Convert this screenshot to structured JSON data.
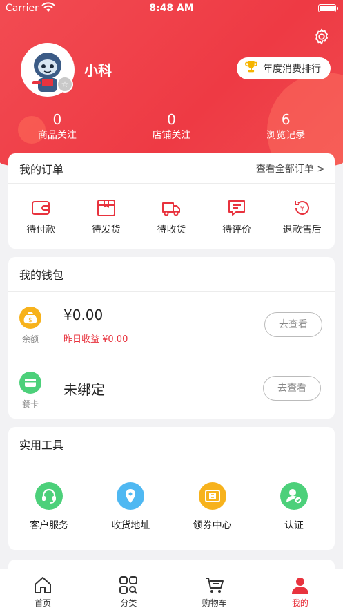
{
  "status_bar": {
    "carrier": "Carrier",
    "time": "8:48 AM"
  },
  "profile": {
    "username": "小科",
    "rank_button": "年度消费排行"
  },
  "stats": [
    {
      "value": "0",
      "label": "商品关注"
    },
    {
      "value": "0",
      "label": "店铺关注"
    },
    {
      "value": "6",
      "label": "浏览记录"
    }
  ],
  "orders": {
    "title": "我的订单",
    "view_all": "查看全部订单 >",
    "items": [
      {
        "label": "待付款",
        "icon": "wallet-icon"
      },
      {
        "label": "待发货",
        "icon": "package-icon"
      },
      {
        "label": "待收货",
        "icon": "truck-icon"
      },
      {
        "label": "待评价",
        "icon": "comment-icon"
      },
      {
        "label": "退款售后",
        "icon": "refund-icon"
      }
    ]
  },
  "wallet": {
    "title": "我的钱包",
    "balance": {
      "icon_label": "余额",
      "amount": "¥0.00",
      "sub": "昨日收益 ¥0.00",
      "button": "去查看"
    },
    "meal_card": {
      "icon_label": "餐卡",
      "amount": "未绑定",
      "button": "去查看"
    }
  },
  "tools": {
    "title": "实用工具",
    "items": [
      {
        "label": "客户服务",
        "icon": "headset-icon",
        "color": "#4cd07a"
      },
      {
        "label": "收货地址",
        "icon": "location-icon",
        "color": "#4fb8f2"
      },
      {
        "label": "领券中心",
        "icon": "coupon-icon",
        "color": "#f7b21c"
      },
      {
        "label": "认证",
        "icon": "verify-user-icon",
        "color": "#4cd07a"
      }
    ]
  },
  "tabbar": [
    {
      "label": "首页",
      "icon": "home-icon"
    },
    {
      "label": "分类",
      "icon": "category-icon"
    },
    {
      "label": "购物车",
      "icon": "cart-icon"
    },
    {
      "label": "我的",
      "icon": "user-icon",
      "active": true
    }
  ],
  "colors": {
    "brand_red": "#ee3a44",
    "accent_red": "#e8333e"
  }
}
